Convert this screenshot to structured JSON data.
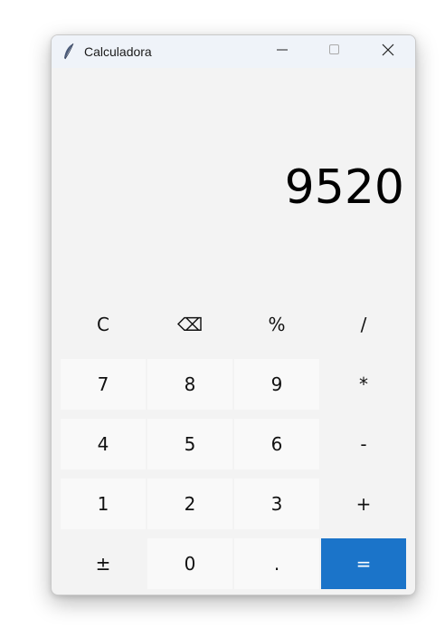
{
  "window": {
    "title": "Calculadora"
  },
  "titlebar_controls": {
    "minimize_icon": "minimize-icon",
    "maximize_icon": "maximize-icon",
    "close_icon": "close-icon"
  },
  "display": {
    "value": "9520"
  },
  "keys": {
    "clear": "C",
    "backspace": "⌫",
    "percent": "%",
    "divide": "/",
    "seven": "7",
    "eight": "8",
    "nine": "9",
    "multiply": "*",
    "four": "4",
    "five": "5",
    "six": "6",
    "minus": "-",
    "one": "1",
    "two": "2",
    "three": "3",
    "plus": "+",
    "negate": "±",
    "zero": "0",
    "decimal": ".",
    "equals": "="
  },
  "colors": {
    "accent": "#1b74c9",
    "window_bg": "#f3f3f3",
    "titlebar_bg": "#eff3f9"
  }
}
